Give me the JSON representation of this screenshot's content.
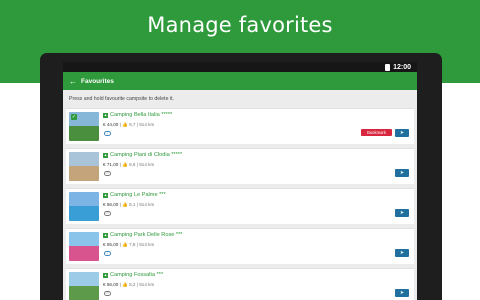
{
  "banner": {
    "title": "Manage favorites"
  },
  "statusbar": {
    "time": "12:00"
  },
  "appbar": {
    "title": "Favourites",
    "back_icon": "arrow-left-icon"
  },
  "hint": "Press and hold favourite campsite to delete it.",
  "colors": {
    "brand": "#2f9a3b",
    "book": "#d7263d",
    "nav": "#1f6f9f"
  },
  "campsites": [
    {
      "name": "Camping Bella Italia *****",
      "price": "€ 44,00",
      "rating": "8,7",
      "distance": "814 km",
      "book_label": "Bookmark",
      "sub_icon": "eye-icon"
    },
    {
      "name": "Camping Piani di Clodia *****",
      "price": "€ 71,00",
      "rating": "8,6",
      "distance": "814 km",
      "book_label": "",
      "sub_icon": "image-icon"
    },
    {
      "name": "Camping Le Palme ***",
      "price": "€ 56,00",
      "rating": "8,1",
      "distance": "814 km",
      "book_label": "",
      "sub_icon": "image-icon"
    },
    {
      "name": "Camping Park Delle Rose ***",
      "price": "€ 55,00",
      "rating": "7,8",
      "distance": "813 km",
      "book_label": "",
      "sub_icon": "eye-icon"
    },
    {
      "name": "Camping Fossalta ***",
      "price": "€ 56,00",
      "rating": "8,2",
      "distance": "814 km",
      "book_label": "",
      "sub_icon": "image-icon"
    }
  ]
}
